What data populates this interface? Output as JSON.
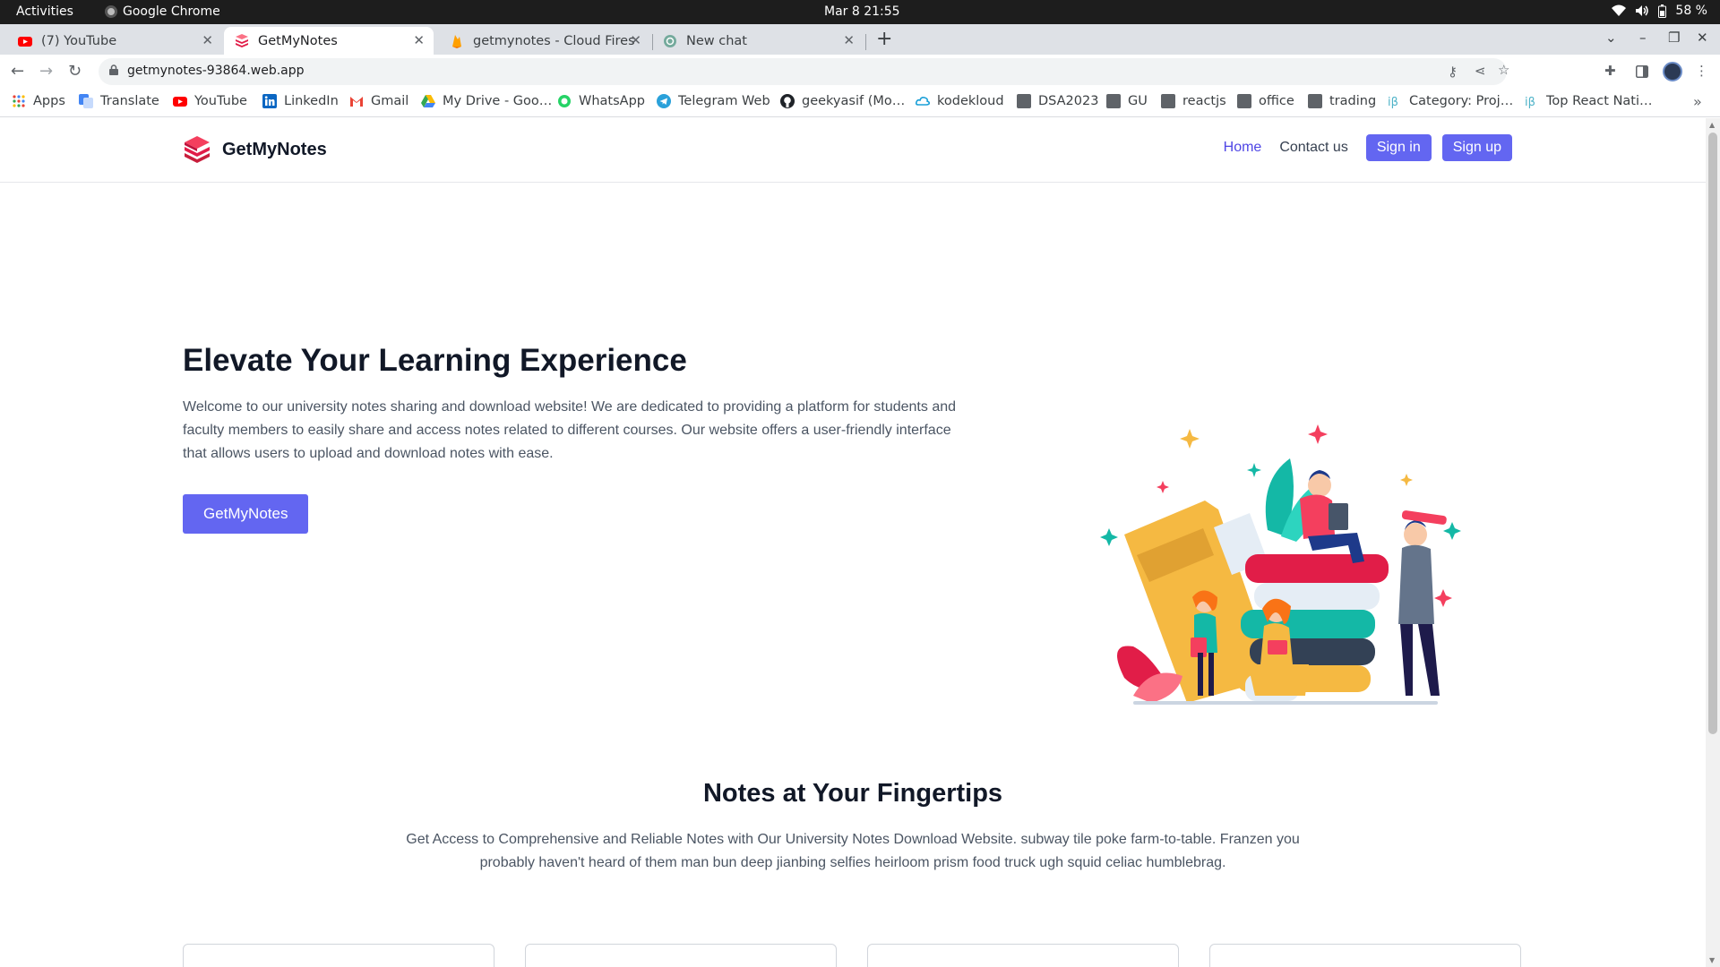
{
  "os": {
    "activities": "Activities",
    "app_name": "Google Chrome",
    "clock": "Mar 8  21:55",
    "battery": "58 %"
  },
  "tabs": [
    {
      "label": "(7) YouTube",
      "icon": "youtube-icon"
    },
    {
      "label": "GetMyNotes",
      "icon": "getmynotes-favicon",
      "active": true
    },
    {
      "label": "getmynotes - Cloud Firest",
      "icon": "firebase-icon"
    },
    {
      "label": "New chat",
      "icon": "chatgpt-icon"
    }
  ],
  "address_bar": {
    "url": "getmynotes-93864.web.app"
  },
  "bookmarks": [
    {
      "label": "Apps",
      "icon": "apps-grid-icon"
    },
    {
      "label": "Translate",
      "icon": "translate-icon"
    },
    {
      "label": "YouTube",
      "icon": "youtube-icon"
    },
    {
      "label": "LinkedIn",
      "icon": "linkedin-icon"
    },
    {
      "label": "Gmail",
      "icon": "gmail-icon"
    },
    {
      "label": "My Drive - Goo…",
      "icon": "drive-icon"
    },
    {
      "label": "WhatsApp",
      "icon": "whatsapp-icon"
    },
    {
      "label": "Telegram Web",
      "icon": "telegram-icon"
    },
    {
      "label": "geekyasif (Mo…",
      "icon": "github-icon"
    },
    {
      "label": "kodekloud",
      "icon": "kodekloud-icon"
    },
    {
      "label": "DSA2023",
      "icon": "folder-icon"
    },
    {
      "label": "GU",
      "icon": "folder-icon"
    },
    {
      "label": "reactjs",
      "icon": "folder-icon"
    },
    {
      "label": "office",
      "icon": "folder-icon"
    },
    {
      "label": "trading",
      "icon": "folder-icon"
    },
    {
      "label": "Category: Proj…",
      "icon": "site-icon"
    },
    {
      "label": "Top React Nati…",
      "icon": "site-icon"
    }
  ],
  "site": {
    "brand": "GetMyNotes",
    "nav": {
      "home": "Home",
      "contact": "Contact us",
      "signin": "Sign in",
      "signup": "Sign up"
    },
    "hero": {
      "title": "Elevate Your Learning Experience",
      "text": "Welcome to our university notes sharing and download website! We are dedicated to providing a platform for students and faculty members to easily share and access notes related to different courses. Our website offers a user-friendly interface that allows users to upload and download notes with ease.",
      "button": "GetMyNotes"
    },
    "notes_section": {
      "title": "Notes at Your Fingertips",
      "text": "Get Access to Comprehensive and Reliable Notes with Our University Notes Download Website. subway tile poke farm-to-table. Franzen you probably haven't heard of them man bun deep jianbing selfies heirloom prism food truck ugh squid celiac humblebrag."
    }
  },
  "colors": {
    "accent": "#6366f1",
    "nav_active": "#4f46e5",
    "brand_red": "#e11d48"
  }
}
